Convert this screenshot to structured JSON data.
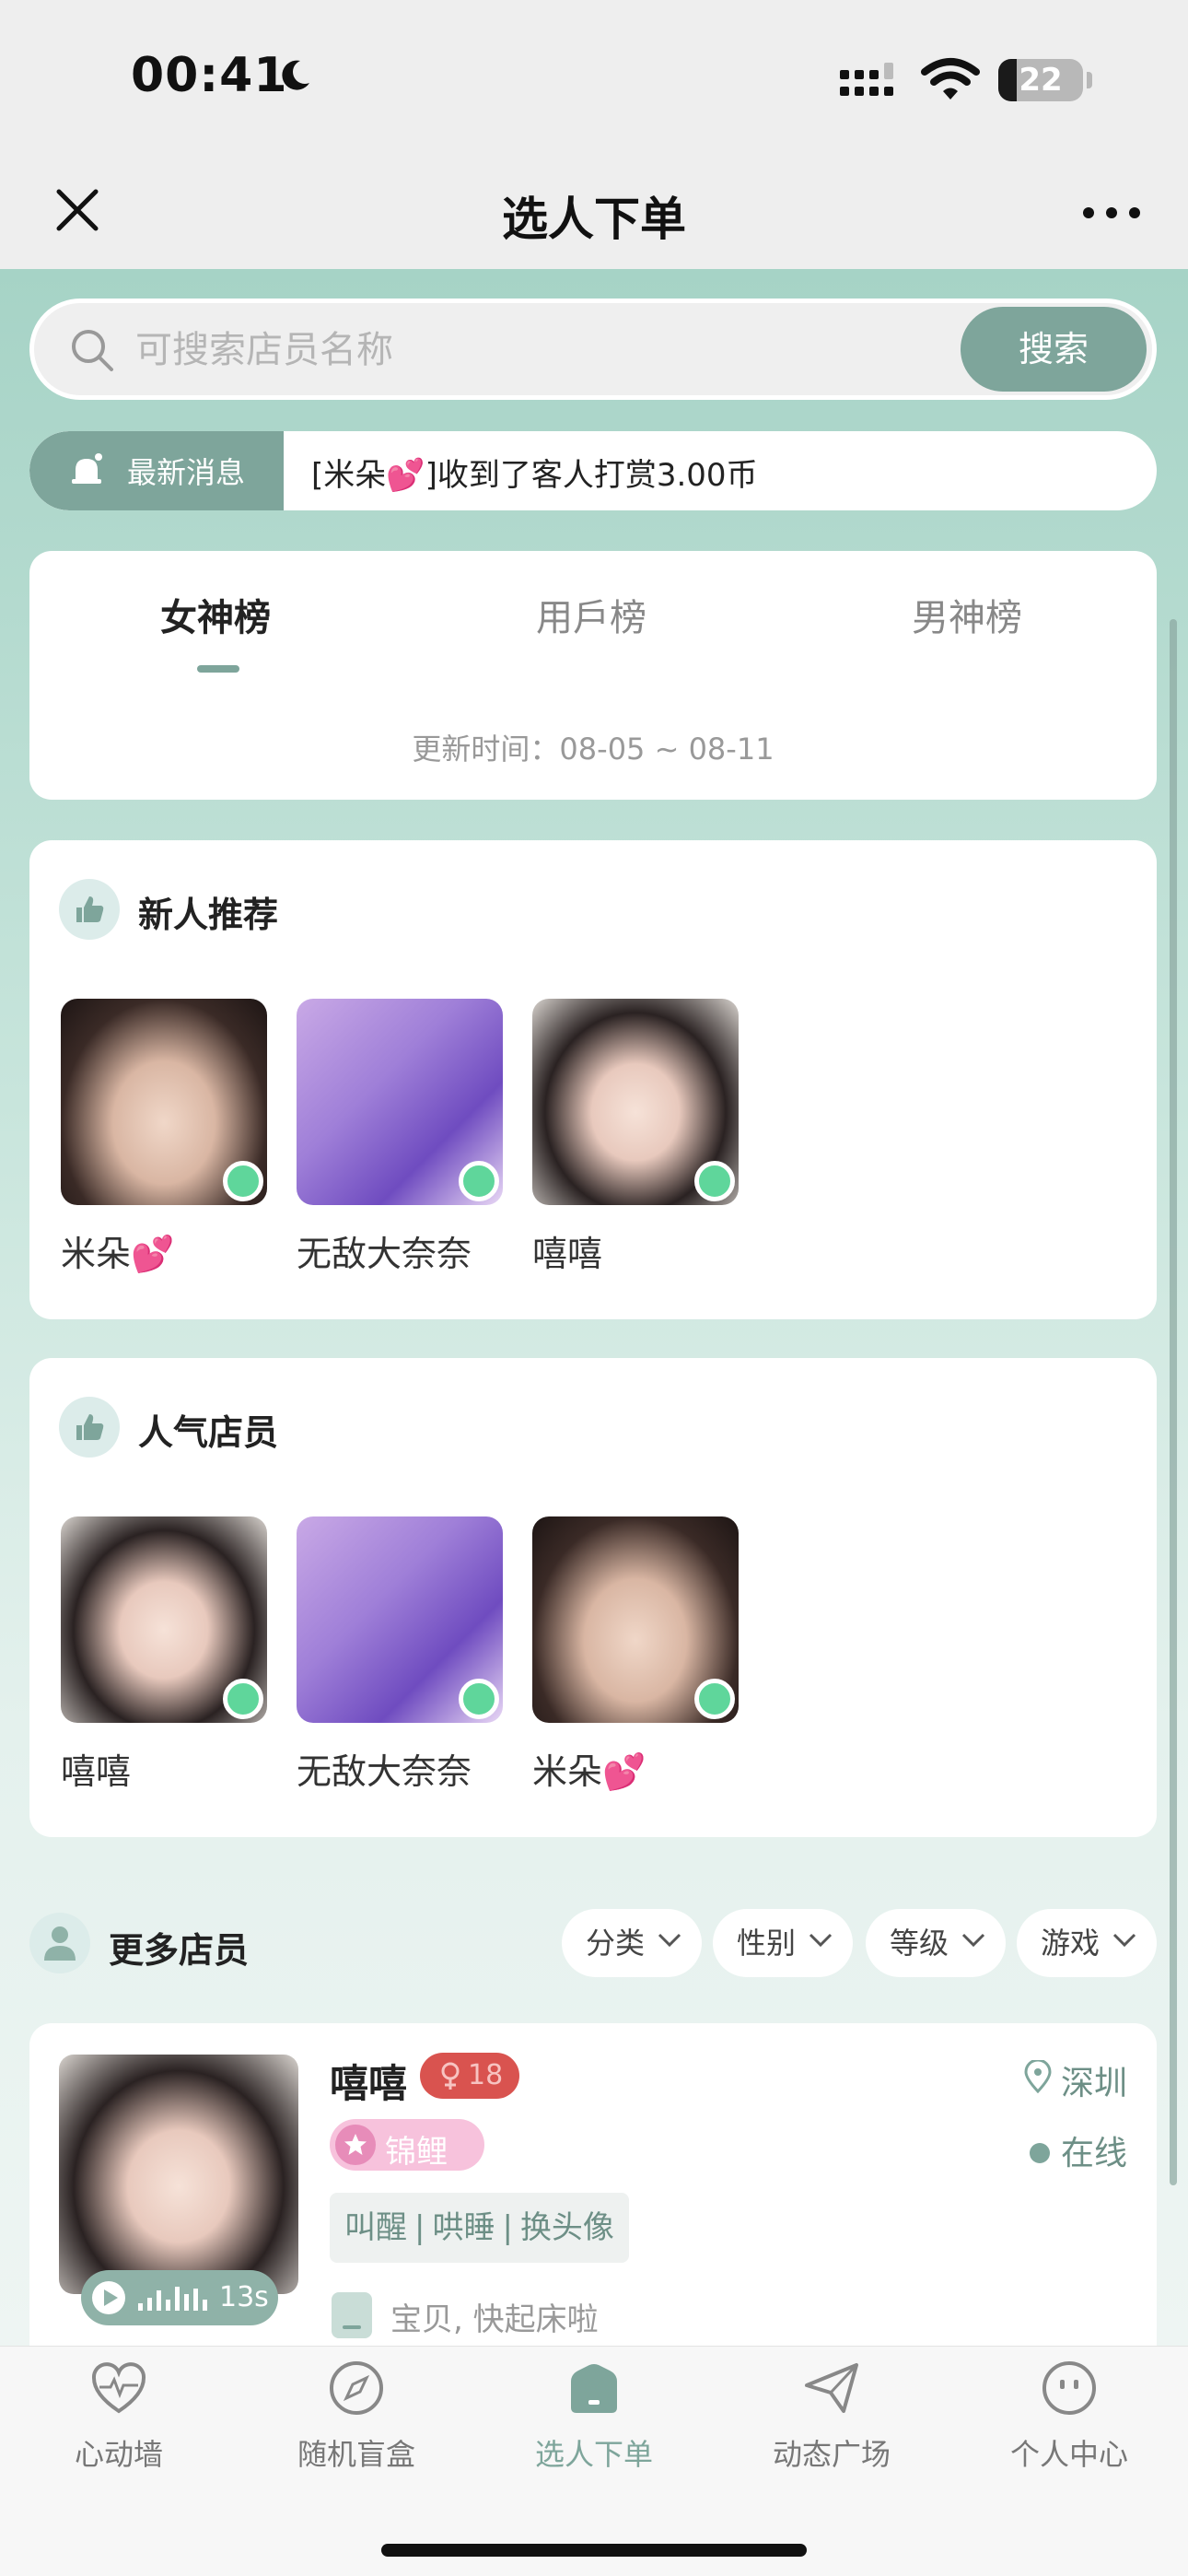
{
  "status_bar": {
    "time": "00:41",
    "battery": "22",
    "battery_level": 0.22
  },
  "nav": {
    "title": "选人下单"
  },
  "search": {
    "placeholder": "可搜索店员名称",
    "button_label": "搜索"
  },
  "news": {
    "tag": "最新消息",
    "text": "[米朵💕]收到了客人打赏3.00币"
  },
  "ranking": {
    "tabs": [
      {
        "label": "女神榜",
        "active": true
      },
      {
        "label": "用戶榜",
        "active": false
      },
      {
        "label": "男神榜",
        "active": false
      }
    ],
    "update_time": "更新时间：08-05 ~ 08-11"
  },
  "new_recommend": {
    "title": "新人推荐",
    "items": [
      {
        "name": "米朵💕",
        "online": true
      },
      {
        "name": "无敌大奈奈",
        "online": true
      },
      {
        "name": "嘻嘻",
        "online": true
      }
    ]
  },
  "popular_staff": {
    "title": "人气店员",
    "items": [
      {
        "name": "嘻嘻",
        "online": true
      },
      {
        "name": "无敌大奈奈",
        "online": true
      },
      {
        "name": "米朵💕",
        "online": true
      }
    ]
  },
  "more_staff": {
    "title": "更多店员",
    "filters": [
      "分类",
      "性别",
      "等级",
      "游戏"
    ]
  },
  "staff_list": [
    {
      "name": "嘻嘻",
      "gender": "female",
      "age": "18",
      "level": "锦鲤",
      "tags": [
        "叫醒",
        "哄睡",
        "换头像"
      ],
      "signature": "宝贝, 快起床啦",
      "city": "深圳",
      "status": "在线",
      "voice_length": "13s"
    }
  ],
  "tab_bar": {
    "items": [
      {
        "label": "心动墙",
        "icon": "heart-pulse-icon",
        "active": false
      },
      {
        "label": "随机盲盒",
        "icon": "compass-icon",
        "active": false
      },
      {
        "label": "选人下单",
        "icon": "home-icon",
        "active": true
      },
      {
        "label": "动态广场",
        "icon": "paper-plane-icon",
        "active": false
      },
      {
        "label": "个人中心",
        "icon": "smiley-face-icon",
        "active": false
      }
    ]
  },
  "colors": {
    "accent": "#7ea59b",
    "online": "#5fd69b",
    "gender_badge": "#d9534f",
    "level_badge": "#f7c2dc"
  }
}
